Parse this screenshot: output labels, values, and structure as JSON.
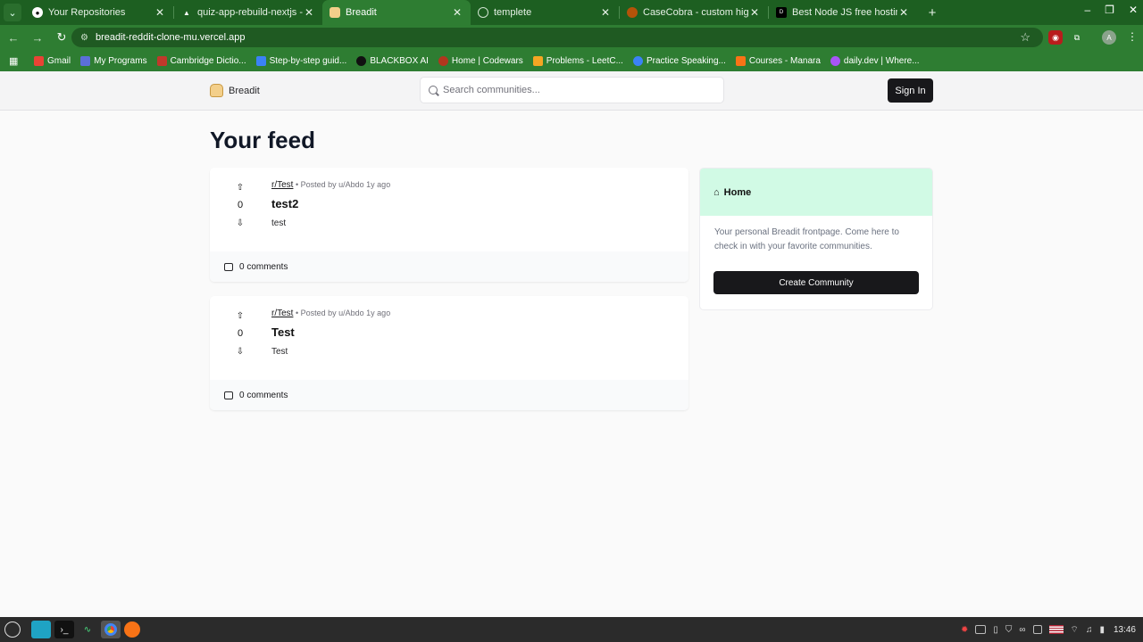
{
  "browser": {
    "tabs": [
      {
        "title": "Your Repositories",
        "icon": "github-icon",
        "active": false
      },
      {
        "title": "quiz-app-rebuild-nextjs - Ove",
        "icon": "vercel-icon",
        "active": false
      },
      {
        "title": "Breadit",
        "icon": "bread-icon",
        "active": true
      },
      {
        "title": "templete",
        "icon": "globe-icon",
        "active": false
      },
      {
        "title": "CaseCobra - custom high-qu",
        "icon": "casecobra-icon",
        "active": false
      },
      {
        "title": "Best Node JS free hosting se",
        "icon": "dev-icon",
        "active": false
      }
    ],
    "url": "breadit-reddit-clone-mu.vercel.app",
    "profile_initial": "A",
    "bookmarks": [
      {
        "label": "Gmail",
        "color": "#ea4335"
      },
      {
        "label": "My Programs",
        "color": "#5b6fd8"
      },
      {
        "label": "Cambridge Dictio...",
        "color": "#c0392b"
      },
      {
        "label": "Step-by-step guid...",
        "color": "#3b82f6"
      },
      {
        "label": "BLACKBOX AI",
        "color": "#111111"
      },
      {
        "label": "Home | Codewars",
        "color": "#b1361e"
      },
      {
        "label": "Problems - LeetC...",
        "color": "#f5a623"
      },
      {
        "label": "Practice Speaking...",
        "color": "#3b82f6"
      },
      {
        "label": "Courses - Manara",
        "color": "#f97316"
      },
      {
        "label": "daily.dev | Where...",
        "color": "#a855f7"
      }
    ]
  },
  "header": {
    "logo_text": "Breadit",
    "search_placeholder": "Search communities...",
    "signin_label": "Sign In"
  },
  "feed": {
    "title": "Your feed",
    "posts": [
      {
        "subreddit": "r/Test",
        "meta": "• Posted by u/Abdo 1y ago",
        "title": "test2",
        "body": "test",
        "votes": "0",
        "comments": "0 comments"
      },
      {
        "subreddit": "r/Test",
        "meta": "• Posted by u/Abdo 1y ago",
        "title": "Test",
        "body": "Test",
        "votes": "0",
        "comments": "0 comments"
      }
    ]
  },
  "sidebar": {
    "heading": "Home",
    "description": "Your personal Breadit frontpage. Come here to check in with your favorite communities.",
    "button_label": "Create Community"
  },
  "taskbar": {
    "clock": "13:46"
  },
  "colors": {
    "chrome_dark": "#1d5f21",
    "chrome": "#2e7d32",
    "sidebar_head": "#d1fae5",
    "button_dark": "#18181b"
  }
}
